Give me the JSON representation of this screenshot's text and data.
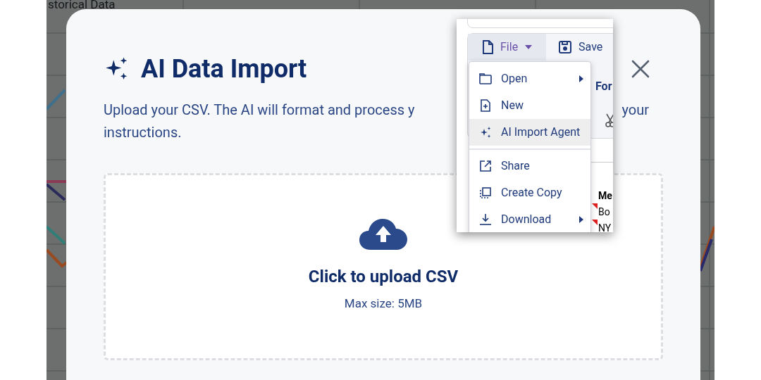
{
  "background": {
    "title": "storical Data"
  },
  "dialog": {
    "title": "AI Data Import",
    "description_fragments": [
      "Upload your CSV. The AI will format and process y",
      "your",
      "instructions."
    ],
    "upload": {
      "label": "Click to upload CSV",
      "hint": "Max size: 5MB"
    }
  },
  "inset": {
    "toolbar": [
      {
        "label": "File",
        "kind": "dropdown",
        "selected": true
      },
      {
        "label": "Save",
        "kind": "button",
        "selected": false
      }
    ],
    "menu_groups": [
      [
        {
          "label": "Open",
          "submenu": true,
          "highlighted": false
        },
        {
          "label": "New",
          "submenu": false,
          "highlighted": false
        },
        {
          "label": "AI Import Agent",
          "submenu": false,
          "highlighted": true
        }
      ],
      [
        {
          "label": "Share",
          "submenu": false,
          "highlighted": false
        },
        {
          "label": "Create Copy",
          "submenu": false,
          "highlighted": false
        },
        {
          "label": "Download",
          "submenu": true,
          "highlighted": false
        }
      ]
    ],
    "behind_tab": "For",
    "cells": [
      {
        "text": "Me",
        "kind": "header"
      },
      {
        "text": "Bo",
        "kind": "cell",
        "comment": true
      },
      {
        "text": "NY",
        "kind": "cell",
        "comment": true
      }
    ]
  }
}
